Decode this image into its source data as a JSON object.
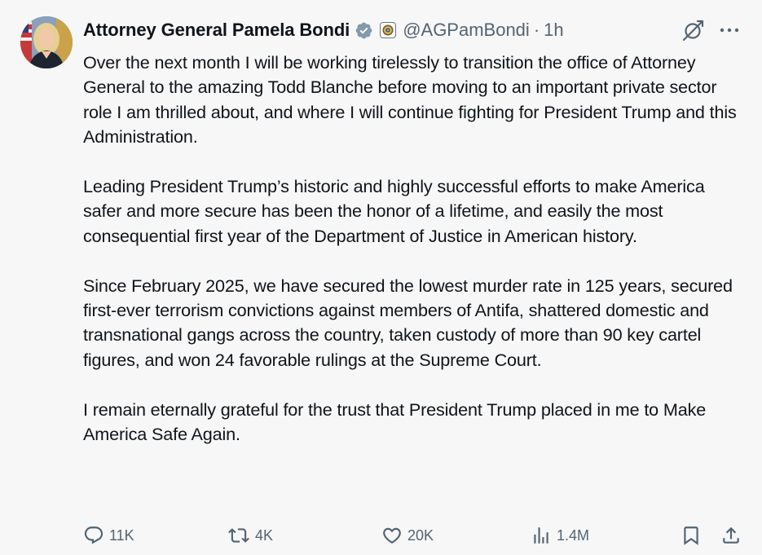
{
  "author": {
    "display_name": "Attorney General Pamela Bondi",
    "handle": "@AGPamBondi",
    "separator": "·",
    "time": "1h"
  },
  "icons": {
    "verified": "verified-badge-icon",
    "affiliate": "doj-seal-icon",
    "grok": "grok-icon",
    "more": "more-options-icon"
  },
  "colors": {
    "text": "#0f1419",
    "secondary": "#536471",
    "verified_badge": "#829aab",
    "background": "#f7f7f7"
  },
  "body": {
    "paragraphs": [
      "Over the next month I will be working tirelessly to transition the office of Attorney General to the amazing Todd Blanche before moving to an important private sector role I am thrilled about, and where I will continue fighting for President Trump and this Administration.",
      "Leading President Trump’s historic and highly successful efforts to make America safer and more secure has been the honor of a lifetime, and easily the most consequential first year of the Department of Justice in American history.",
      "Since February 2025, we have secured the lowest murder rate in 125 years, secured first-ever terrorism convictions against members of Antifa, shattered domestic and transnational gangs across the country, taken custody of more than 90 key cartel figures, and won 24 favorable rulings at the Supreme Court.",
      "I remain eternally grateful for the trust that President Trump placed in me to Make America Safe Again."
    ]
  },
  "actions": {
    "replies": "11K",
    "reposts": "4K",
    "likes": "20K",
    "views": "1.4M"
  }
}
